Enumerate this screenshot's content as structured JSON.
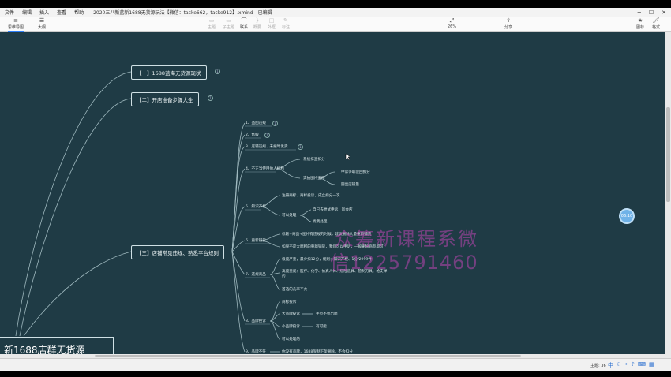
{
  "menubar": {
    "items": [
      "文件",
      "编辑",
      "插入",
      "查看",
      "帮助"
    ],
    "window_title": "2020三八新蓝新1688无货源玩法【微信：tacke662，tacke912】.xmind - 已编辑"
  },
  "toolbar": {
    "mindmap": "思维导图",
    "outline": "大纲",
    "topic": "主题",
    "subtopic": "子主题",
    "relation": "联系",
    "summary": "概要",
    "frame": "外框",
    "note": "标注",
    "zoom": "26%",
    "share": "分享",
    "icons": "图标",
    "format": "格式"
  },
  "canvas": {
    "root": "新1688店群无货源",
    "topic1": "【一】1688蓝海无货源现状",
    "topic2": "【二】开店准备步骤大全",
    "topic3": "【三】店铺常见违规、熟悉平台规则",
    "n1": "1、盗图违规",
    "n2": "2、售假",
    "n3": "3、店铺违规、未按时发货",
    "n4": "4、不正当使用他人权利",
    "n4a": "系统排查扣分",
    "n4b": "实拍图片盗用",
    "n4b1": "申诉争取驳回扣分",
    "n4b2": "圆出店铺量",
    "n5": "5、知识产权",
    "n5a": "注册商标、商标投诉，成立扣分一次",
    "n5b": "可以处理",
    "n5b1": "自己去尝试申诉，就会店",
    "n5b2": "找我处理",
    "n6": "6、重新铺货",
    "n6a": "标题+商品+图片有违规的时候，建议删除大量重新铺货",
    "n6b": "如果不是大面积的重新铺货，我们可以申诉，一般删除商品即可",
    "n7": "7、违规商品",
    "n7a": "极度严重，最少扣12分，规则：知识产权、1分/2999件",
    "n7b": "高度重视：医疗、化学、仿真人体、危险道具、管制刀具、枪支弹药",
    "n7c": "首选的几率不大",
    "n8": "8、品牌投诉",
    "n8a": "商标投诉",
    "n8b": "大品牌投诉",
    "n8b1": "手页不会出面",
    "n8c": "小品牌投诉",
    "n8c1": "有可能",
    "n8d": "可以处理的",
    "n9": "9、品牌不符",
    "n9a": "你没有品牌，1688限制下架删除，不会扣分",
    "b1": "1",
    "b2": "1",
    "b3": "1",
    "b4": "1",
    "b5": "1"
  },
  "watermark": {
    "line1": "众筹新课程系微",
    "line2": "信1225791460"
  },
  "timer": "06:10",
  "status": {
    "theme": "主题: 36"
  }
}
